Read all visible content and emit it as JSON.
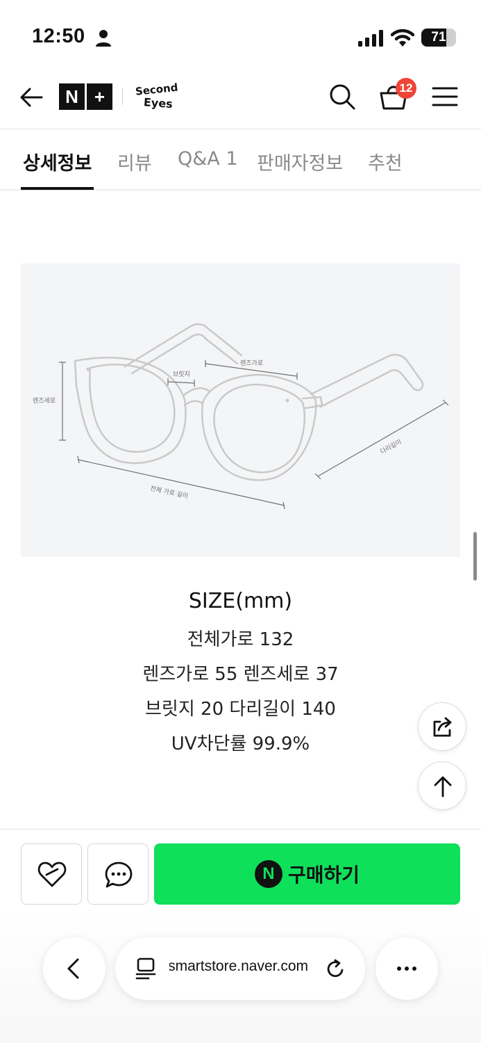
{
  "status_bar": {
    "time": "12:50",
    "battery_level": "71"
  },
  "header": {
    "store_badge_left": "N",
    "store_badge_right": "+",
    "brand_logo_text": "Second Eyes",
    "cart_count": "12"
  },
  "tabs": [
    {
      "label": "상세정보",
      "active": true
    },
    {
      "label": "리뷰",
      "active": false
    },
    {
      "label": "Q&A 1",
      "active": false
    },
    {
      "label": "판매자정보",
      "active": false
    },
    {
      "label": "추천",
      "active": false
    }
  ],
  "diagram": {
    "labels": {
      "bridge": "브릿지",
      "lens_width": "렌즈가로",
      "lens_height": "렌즈세로",
      "total_width": "전체 가로 길이",
      "temple_length": "다리길이"
    }
  },
  "size_info": {
    "title": "SIZE(mm)",
    "lines": [
      "전체가로 132",
      "렌즈가로 55 렌즈세로 37",
      "브릿지 20 다리길이 140",
      "UV차단률 99.9%"
    ]
  },
  "purchase_bar": {
    "buy_badge": "N",
    "buy_label": "구매하기"
  },
  "browser": {
    "url": "smartstore.naver.com"
  },
  "colors": {
    "buy_green": "#0ee05a",
    "badge_red": "#f04438"
  }
}
